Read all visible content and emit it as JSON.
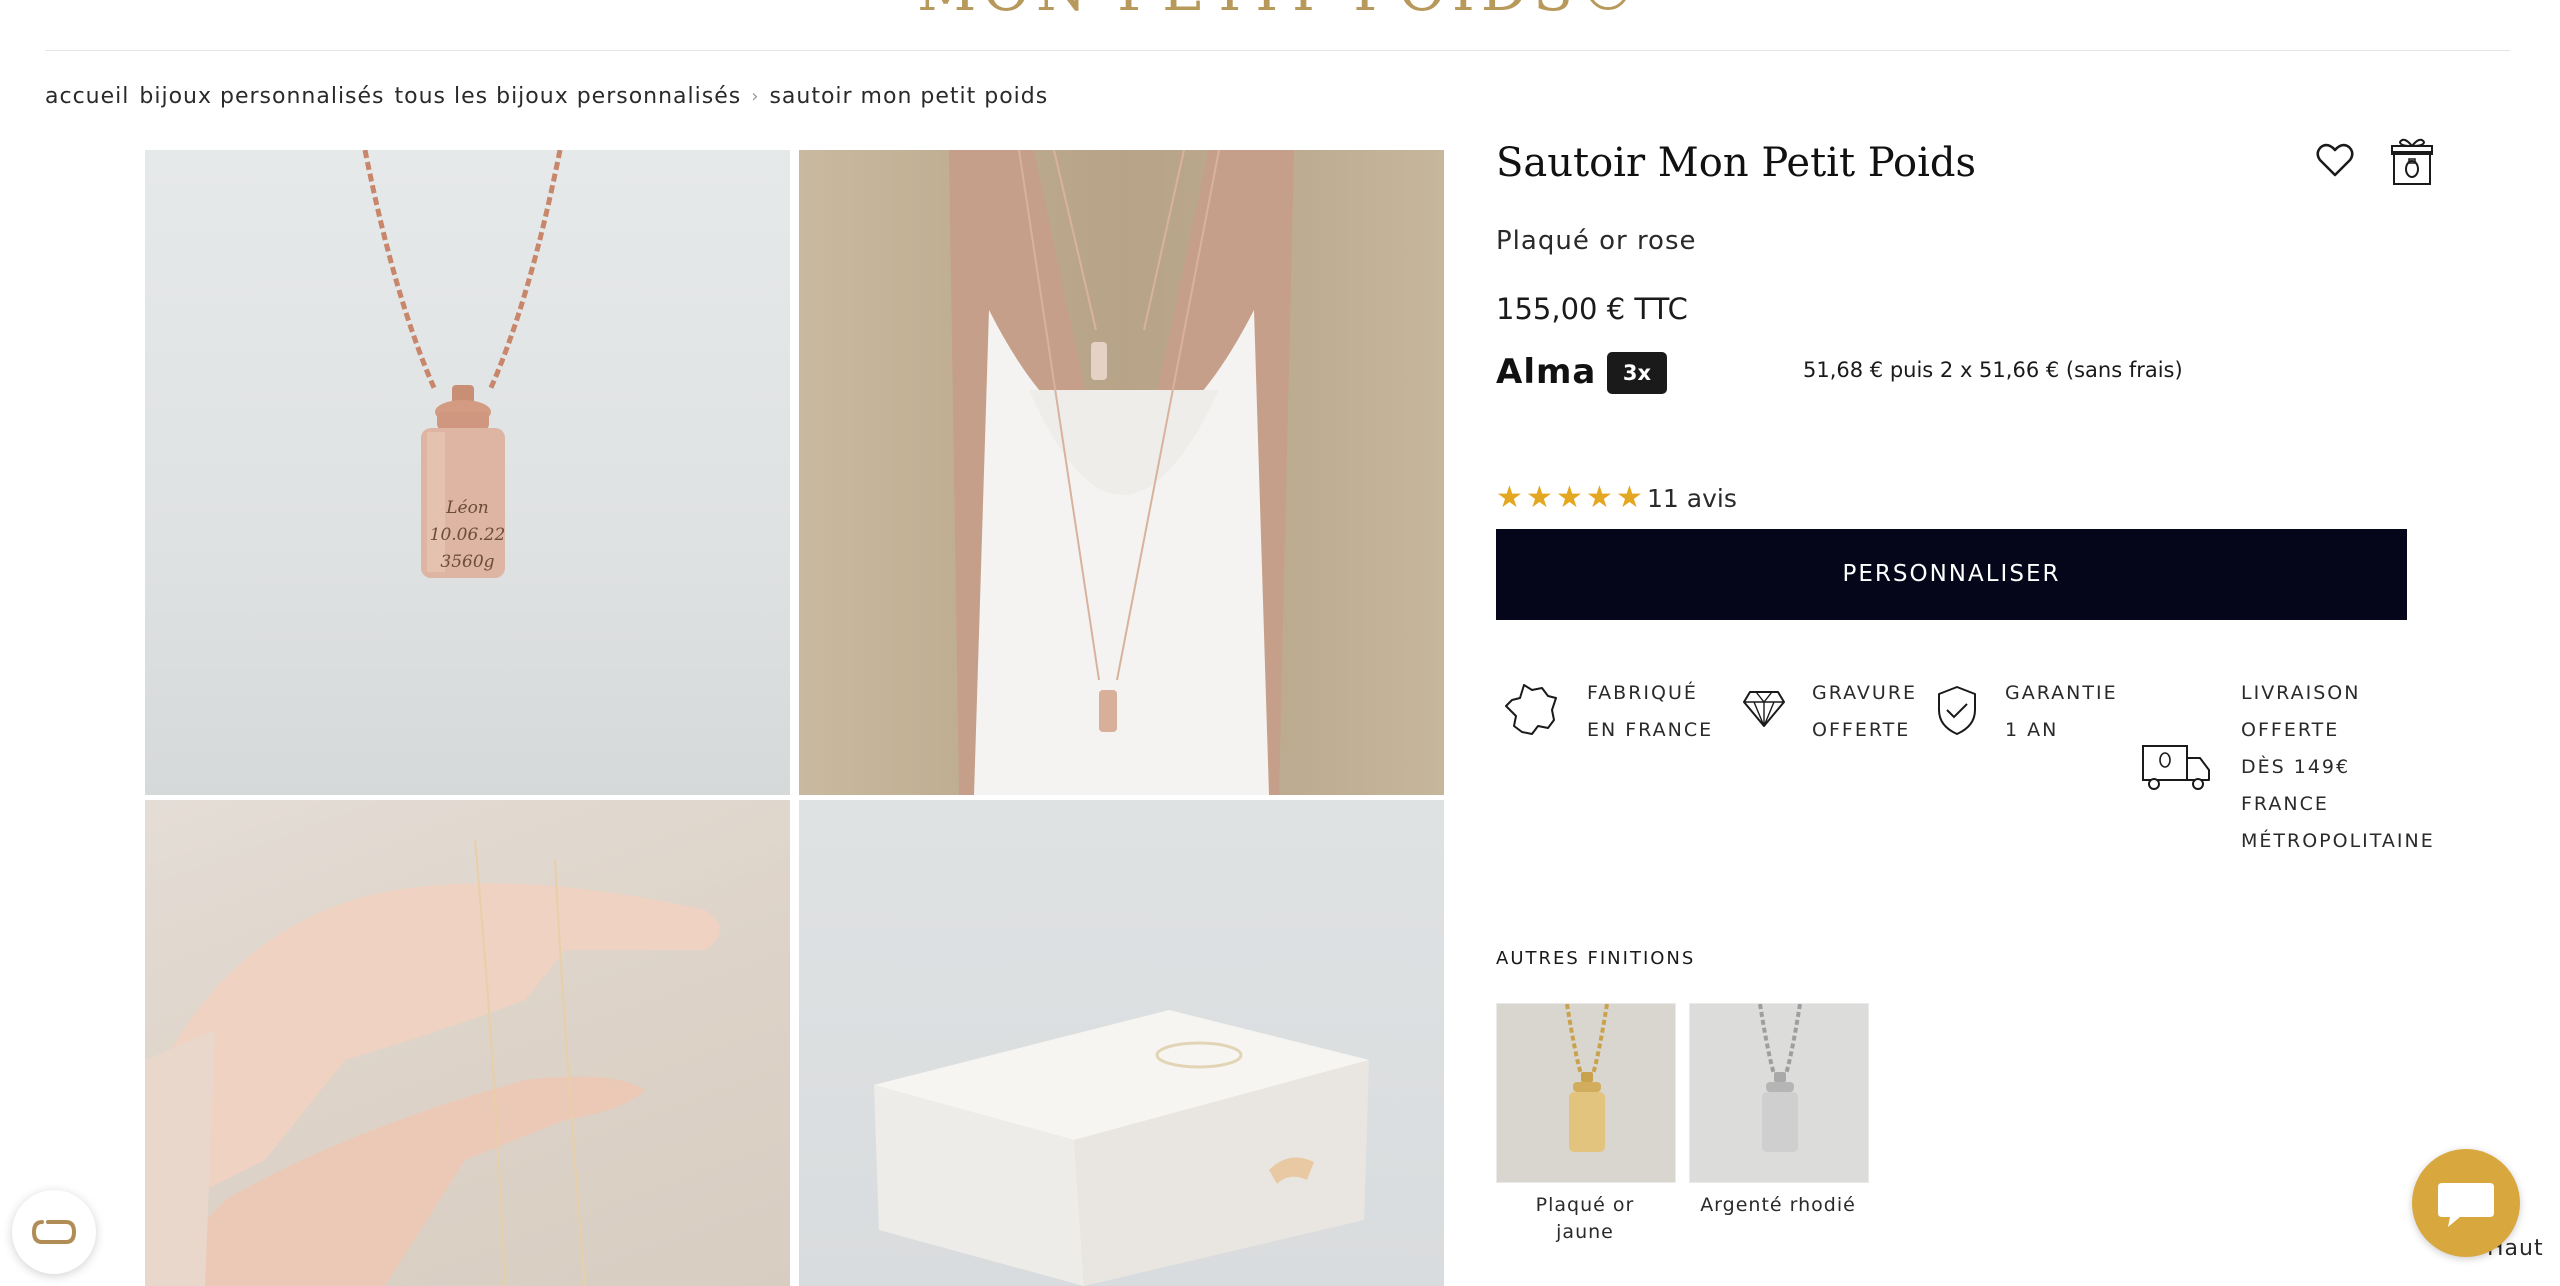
{
  "header": {
    "logo_text": "MON PETIT POIDS®"
  },
  "breadcrumb": {
    "items": [
      "accueil",
      "bijoux personnalisés",
      "tous les bijoux personnalisés",
      "sautoir mon petit poids"
    ],
    "separator": "›"
  },
  "gallery": {
    "engraving_lines": [
      "Léon",
      "10.06.22",
      "3560g"
    ]
  },
  "product": {
    "title": "Sautoir Mon Petit Poids",
    "finish": "Plaqué or rose",
    "price": "155,00 € TTC",
    "payment": {
      "provider": "Alma",
      "badge": "3x",
      "installments": "51,68 € puis 2 x 51,66 € (sans frais)"
    },
    "rating": {
      "stars": 5,
      "reviews": "11 avis"
    },
    "cta_label": "PERSONNALISER",
    "icons": {
      "wishlist": "heart-icon",
      "gift": "gift-box-icon"
    }
  },
  "features": [
    {
      "icon": "france-map-icon",
      "lines": [
        "FABRIQUÉ",
        "EN FRANCE"
      ]
    },
    {
      "icon": "diamond-icon",
      "lines": [
        "GRAVURE",
        "OFFERTE"
      ]
    },
    {
      "icon": "shield-check-icon",
      "lines": [
        "GARANTIE",
        "1 AN"
      ]
    },
    {
      "icon": "delivery-truck-icon",
      "lines": [
        "LIVRAISON",
        "OFFERTE",
        "DÈS 149€",
        "FRANCE",
        "MÉTROPOLITAINE"
      ]
    }
  ],
  "finitions": {
    "title": "AUTRES FINITIONS",
    "options": [
      {
        "label_lines": [
          "Plaqué or",
          "jaune"
        ]
      },
      {
        "label_lines": [
          "Argenté rhodié"
        ]
      }
    ]
  },
  "widgets": {
    "back_to_top": "Haut",
    "back_to_top_arrow": "^"
  },
  "colors": {
    "brand_gold": "#b79a5b",
    "cta_background": "#05061a",
    "star": "#e3a722",
    "chat_button": "#d8a83e"
  }
}
